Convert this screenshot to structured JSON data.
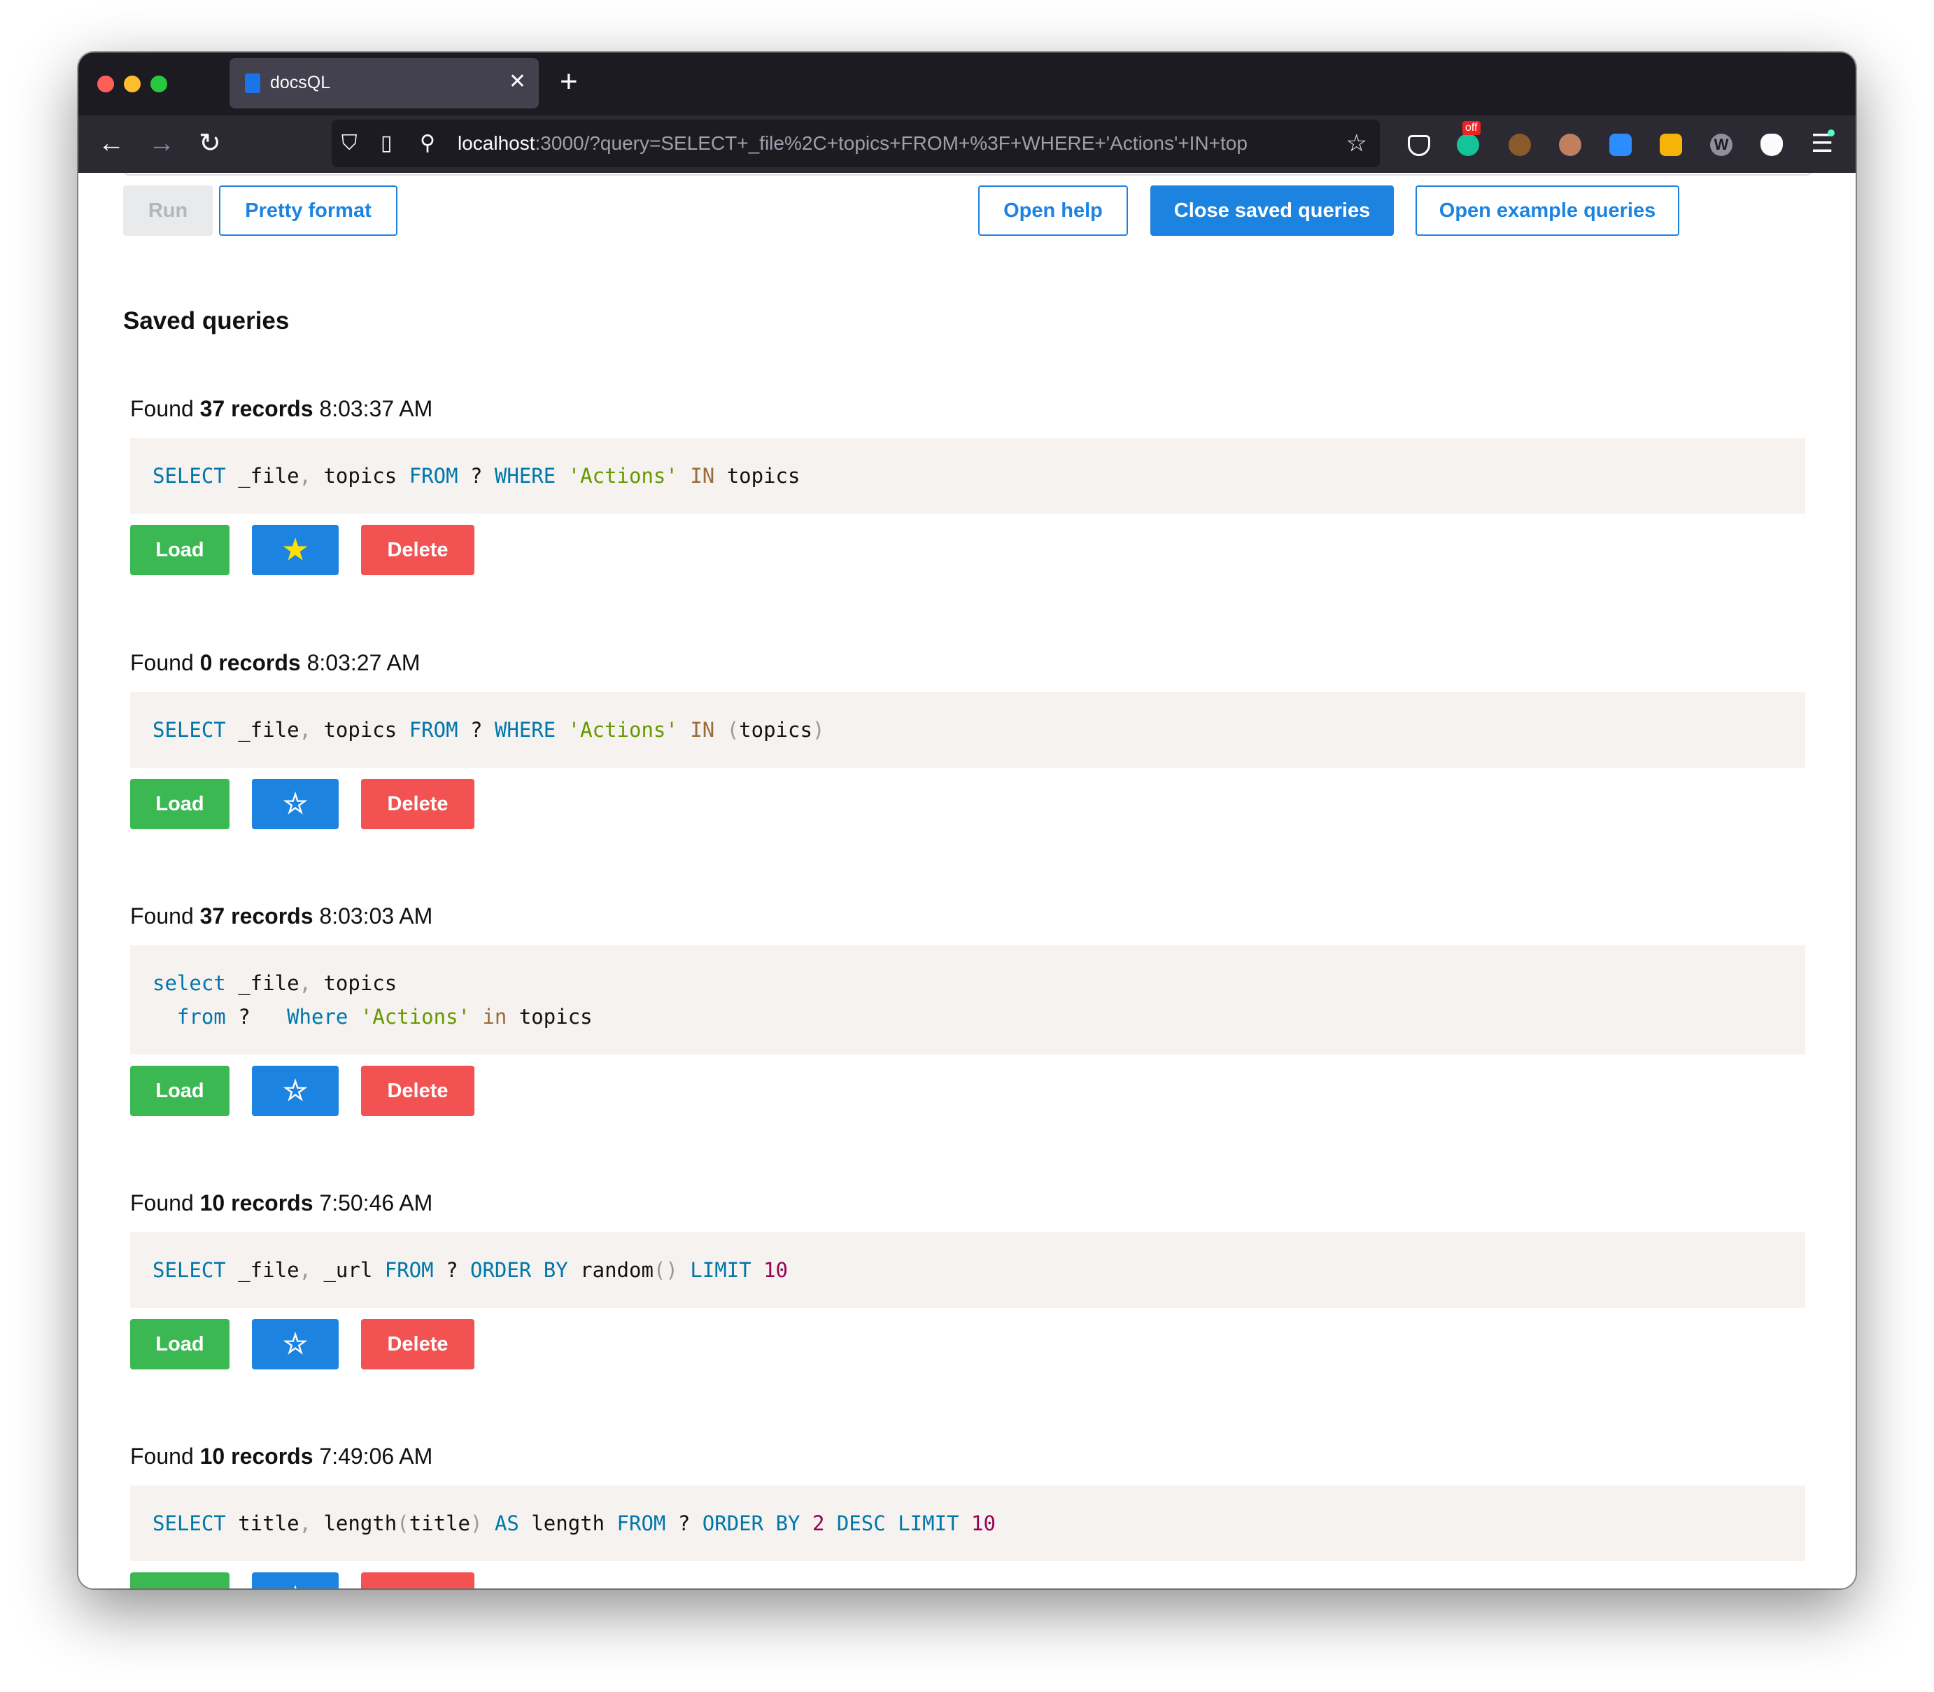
{
  "browser": {
    "tab_title": "docsQL",
    "tab_close_icon": "✕",
    "new_tab_icon": "+",
    "back_icon": "←",
    "forward_icon": "→",
    "reload_icon": "↻",
    "url_host": "localhost",
    "url_rest": ":3000/?query=SELECT+_file%2C+topics+FROM+%3F+WHERE+'Actions'+IN+top",
    "bookmark_icon": "☆",
    "extension_badge": "off",
    "menu_icon": "☰"
  },
  "toolbar": {
    "run_label": "Run",
    "pretty_label": "Pretty format",
    "help_label": "Open help",
    "close_saved_label": "Close saved queries",
    "examples_label": "Open example queries"
  },
  "saved": {
    "title": "Saved queries",
    "found_prefix": "Found",
    "records_suffix": "records",
    "load_label": "Load",
    "delete_label": "Delete",
    "star_filled_icon": "★",
    "star_empty_icon": "☆",
    "queries": [
      {
        "count": "37",
        "time": "8:03:37 AM",
        "starred": true,
        "lines": [
          [
            [
              "kw",
              "SELECT"
            ],
            [
              "t",
              " _file"
            ],
            [
              "pn",
              ","
            ],
            [
              "t",
              " topics "
            ],
            [
              "kw",
              "FROM"
            ],
            [
              "t",
              " ? "
            ],
            [
              "kw",
              "WHERE"
            ],
            [
              "t",
              " "
            ],
            [
              "str",
              "'Actions'"
            ],
            [
              "t",
              " "
            ],
            [
              "op",
              "IN"
            ],
            [
              "t",
              " topics"
            ]
          ]
        ]
      },
      {
        "count": "0",
        "time": "8:03:27 AM",
        "starred": false,
        "lines": [
          [
            [
              "kw",
              "SELECT"
            ],
            [
              "t",
              " _file"
            ],
            [
              "pn",
              ","
            ],
            [
              "t",
              " topics "
            ],
            [
              "kw",
              "FROM"
            ],
            [
              "t",
              " ? "
            ],
            [
              "kw",
              "WHERE"
            ],
            [
              "t",
              " "
            ],
            [
              "str",
              "'Actions'"
            ],
            [
              "t",
              " "
            ],
            [
              "op",
              "IN"
            ],
            [
              "t",
              " "
            ],
            [
              "pn",
              "("
            ],
            [
              "t",
              "topics"
            ],
            [
              "pn",
              ")"
            ]
          ]
        ]
      },
      {
        "count": "37",
        "time": "8:03:03 AM",
        "starred": false,
        "lines": [
          [
            [
              "kw",
              "select"
            ],
            [
              "t",
              " _file"
            ],
            [
              "pn",
              ","
            ],
            [
              "t",
              " topics"
            ]
          ],
          [
            [
              "t",
              "  "
            ],
            [
              "kw",
              "from"
            ],
            [
              "t",
              " ?   "
            ],
            [
              "kw",
              "Where"
            ],
            [
              "t",
              " "
            ],
            [
              "str",
              "'Actions'"
            ],
            [
              "t",
              " "
            ],
            [
              "op",
              "in"
            ],
            [
              "t",
              " topics"
            ]
          ]
        ]
      },
      {
        "count": "10",
        "time": "7:50:46 AM",
        "starred": false,
        "lines": [
          [
            [
              "kw",
              "SELECT"
            ],
            [
              "t",
              " _file"
            ],
            [
              "pn",
              ","
            ],
            [
              "t",
              " _url "
            ],
            [
              "kw",
              "FROM"
            ],
            [
              "t",
              " ? "
            ],
            [
              "kw",
              "ORDER"
            ],
            [
              "t",
              " "
            ],
            [
              "kw",
              "BY"
            ],
            [
              "t",
              " random"
            ],
            [
              "pn",
              "()"
            ],
            [
              "t",
              " "
            ],
            [
              "kw",
              "LIMIT"
            ],
            [
              "t",
              " "
            ],
            [
              "num",
              "10"
            ]
          ]
        ]
      },
      {
        "count": "10",
        "time": "7:49:06 AM",
        "starred": false,
        "lines": [
          [
            [
              "kw",
              "SELECT"
            ],
            [
              "t",
              " title"
            ],
            [
              "pn",
              ","
            ],
            [
              "t",
              " length"
            ],
            [
              "pn",
              "("
            ],
            [
              "t",
              "title"
            ],
            [
              "pn",
              ")"
            ],
            [
              "t",
              " "
            ],
            [
              "kw",
              "AS"
            ],
            [
              "t",
              " length "
            ],
            [
              "kw",
              "FROM"
            ],
            [
              "t",
              " ? "
            ],
            [
              "kw",
              "ORDER"
            ],
            [
              "t",
              " "
            ],
            [
              "kw",
              "BY"
            ],
            [
              "t",
              " "
            ],
            [
              "num",
              "2"
            ],
            [
              "t",
              " "
            ],
            [
              "kw",
              "DESC"
            ],
            [
              "t",
              " "
            ],
            [
              "kw",
              "LIMIT"
            ],
            [
              "t",
              " "
            ],
            [
              "num",
              "10"
            ]
          ]
        ]
      }
    ]
  }
}
